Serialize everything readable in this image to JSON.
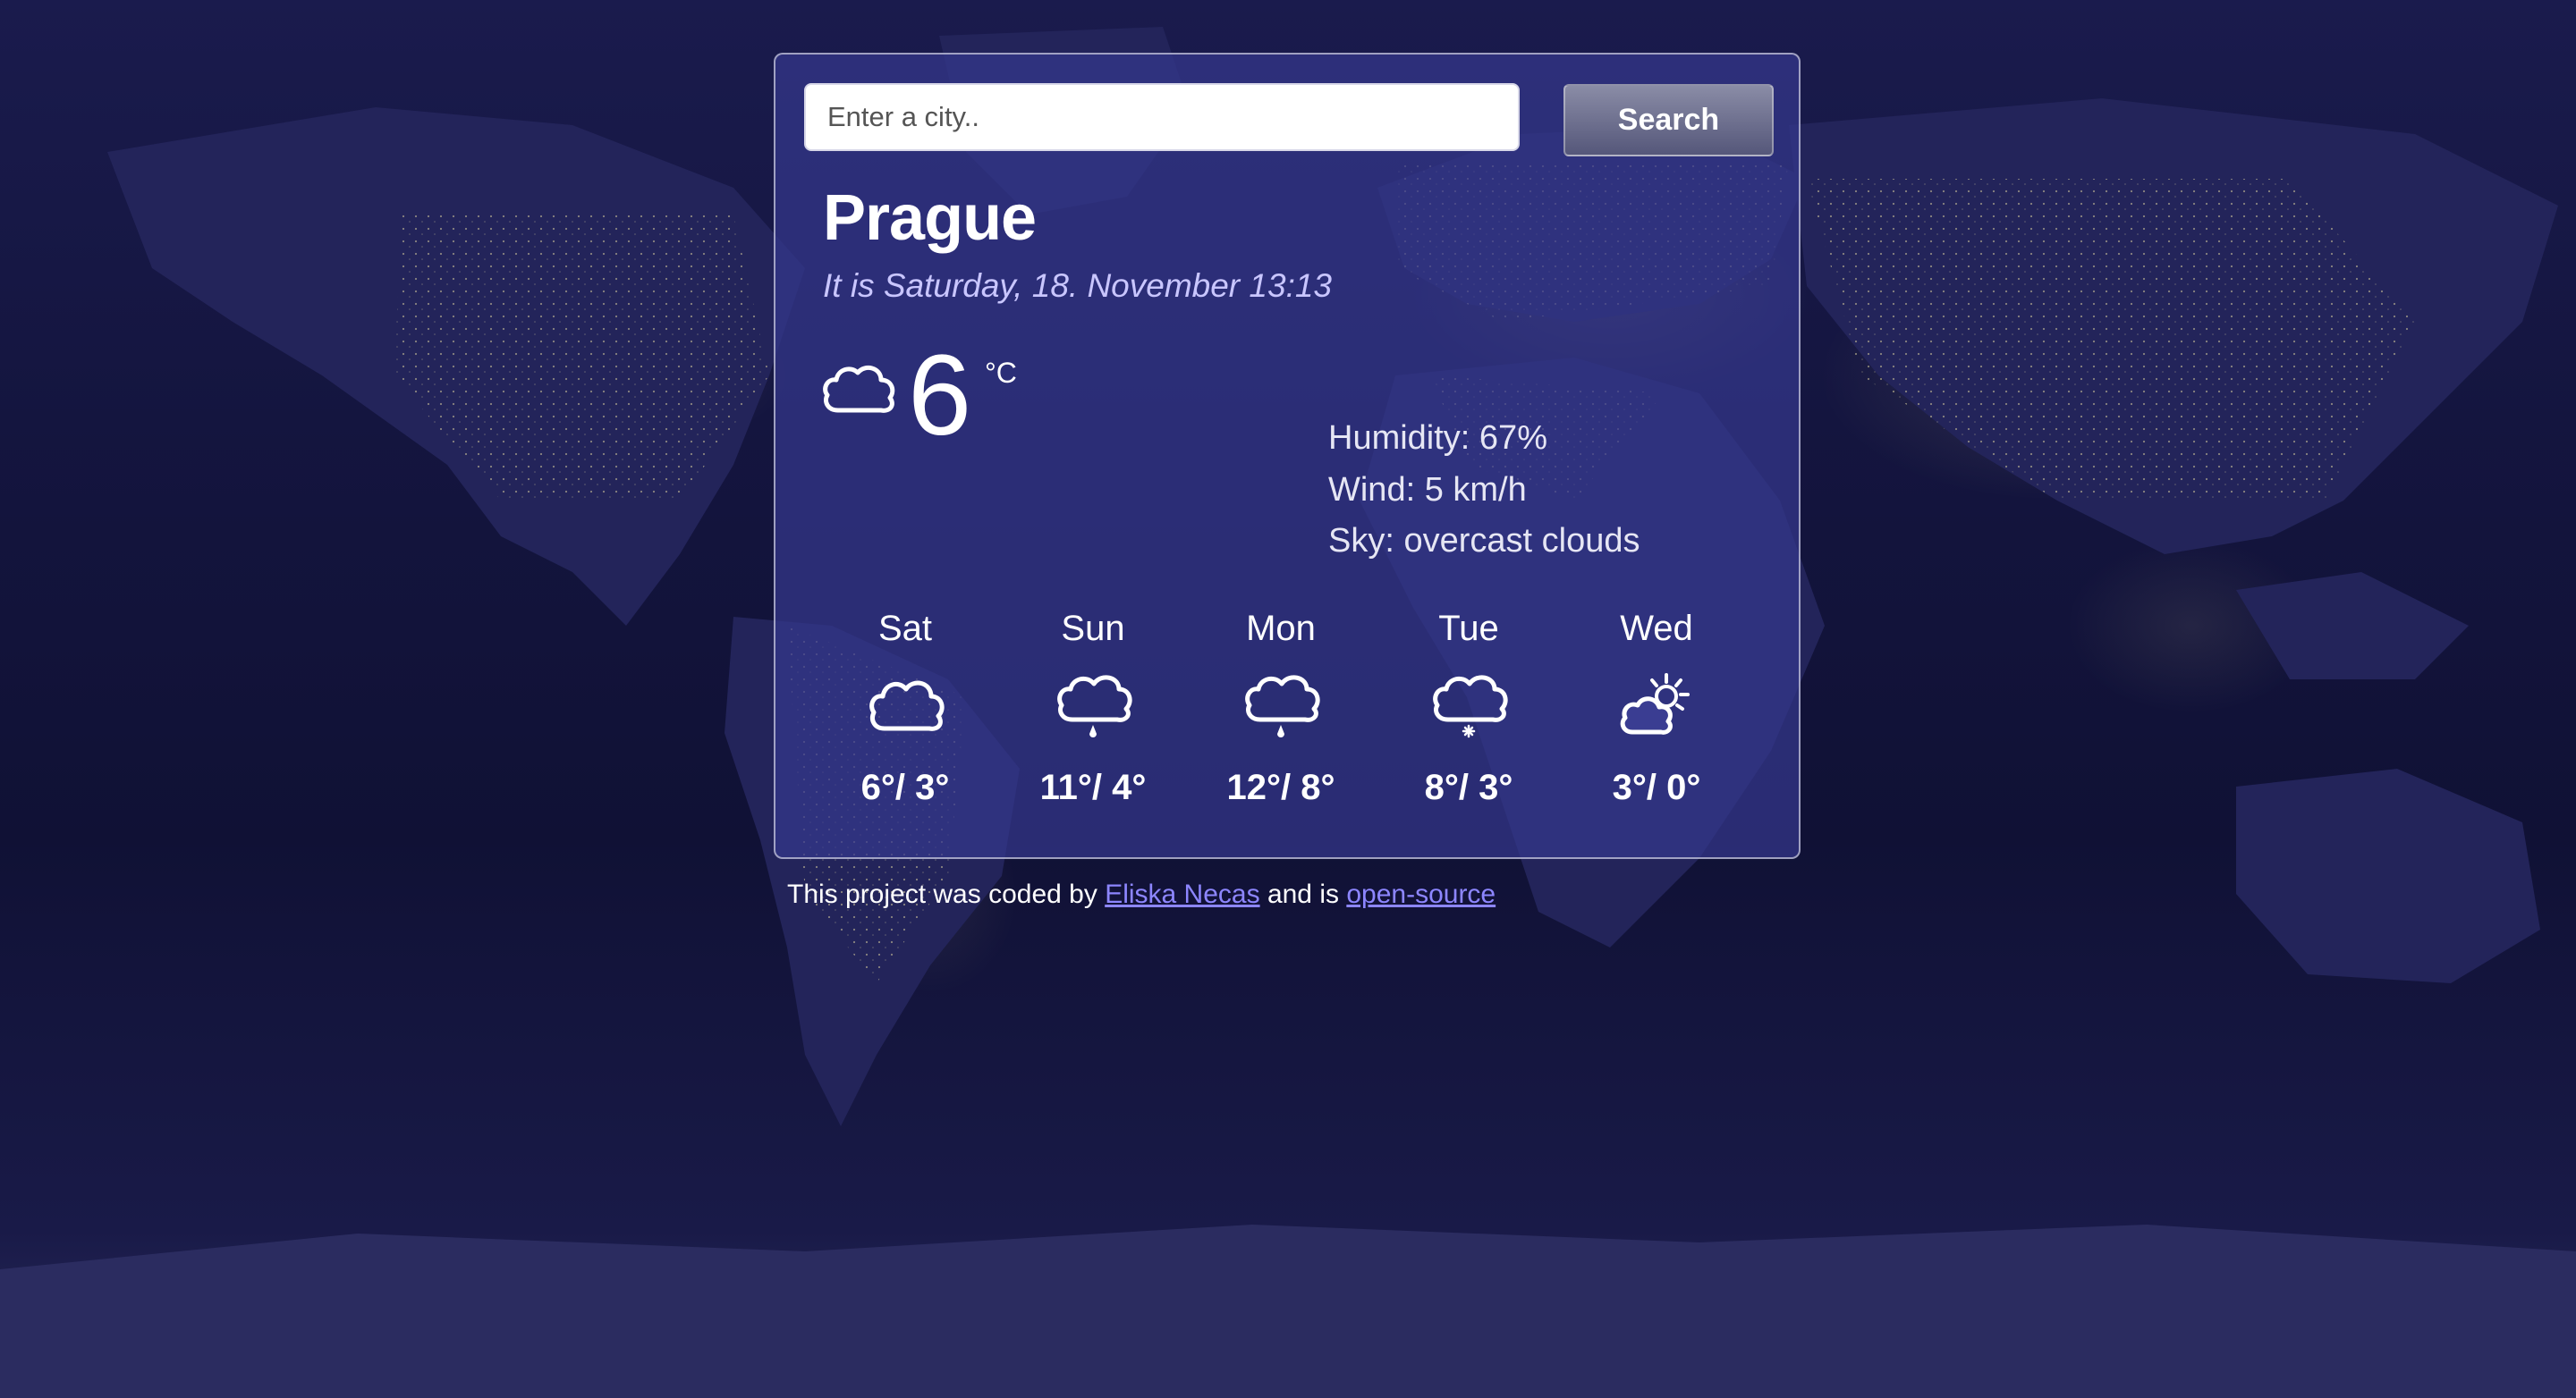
{
  "search": {
    "placeholder": "Enter a city..",
    "button_label": "Search"
  },
  "current": {
    "city": "Prague",
    "date_line": "It is Saturday, 18. November 13:13",
    "temperature": "6",
    "unit": "°C",
    "icon": "cloud-icon",
    "humidity": "Humidity: 67%",
    "wind": "Wind: 5 km/h",
    "sky": "Sky: overcast clouds"
  },
  "forecast": [
    {
      "day": "Sat",
      "icon": "cloud-icon",
      "temps": "6°/ 3°"
    },
    {
      "day": "Sun",
      "icon": "rain-cloud-icon",
      "temps": "11°/ 4°"
    },
    {
      "day": "Mon",
      "icon": "rain-cloud-icon",
      "temps": "12°/ 8°"
    },
    {
      "day": "Tue",
      "icon": "snow-cloud-icon",
      "temps": "8°/ 3°"
    },
    {
      "day": "Wed",
      "icon": "partly-sunny-icon",
      "temps": "3°/ 0°"
    }
  ],
  "footer": {
    "prefix": "This project was coded by",
    "author_link": "Eliska Necas",
    "middle": "and is",
    "source_link": "open-source"
  },
  "colors": {
    "background": "#14153f",
    "card": "#34378c",
    "date_text": "#c9c6ff",
    "link": "#8d86ff"
  }
}
